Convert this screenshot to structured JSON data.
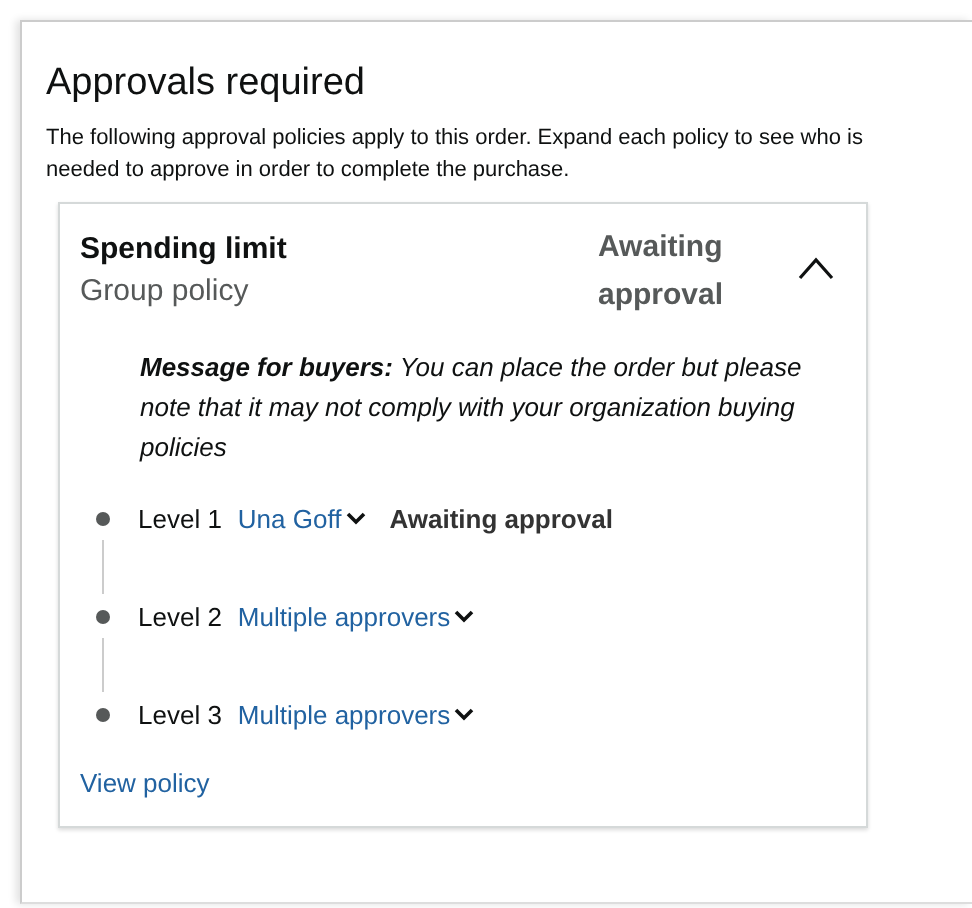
{
  "title": "Approvals required",
  "description": "The following approval policies apply to this order. Expand each policy to see who is needed to approve in order to complete the purchase.",
  "policy": {
    "name": "Spending limit",
    "type": "Group policy",
    "status": "Awaiting approval",
    "expanded": true,
    "message": "**Message for buyers:** You can place the order but please note that it may not comply with your organization buying policies",
    "levels": [
      {
        "label": "Level 1",
        "approver": "Una Goff",
        "status": "Awaiting approval"
      },
      {
        "label": "Level 2",
        "approver": "Multiple approvers"
      },
      {
        "label": "Level 3",
        "approver": "Multiple approvers"
      }
    ],
    "link": "View policy"
  }
}
